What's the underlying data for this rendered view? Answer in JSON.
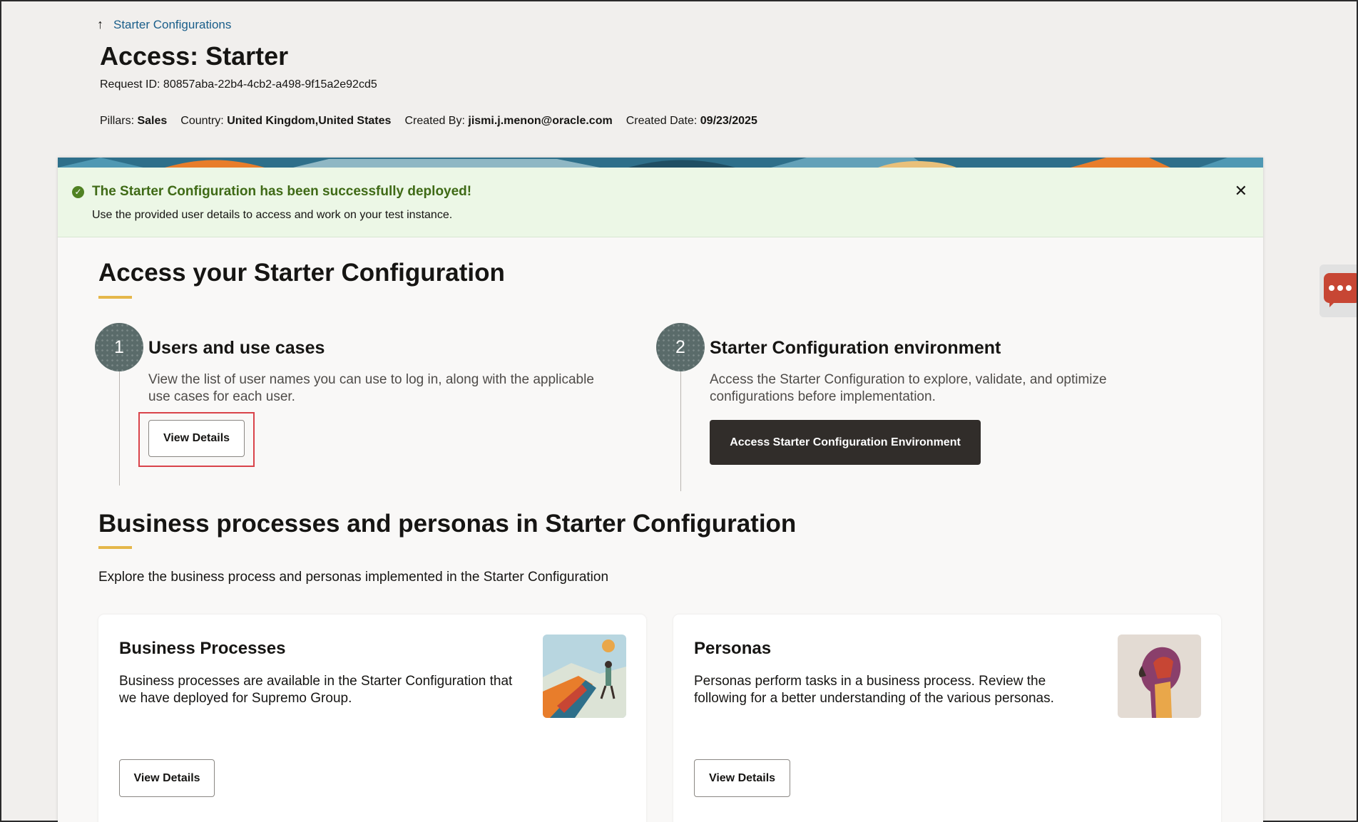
{
  "breadcrumb": {
    "back_label": "Starter Configurations"
  },
  "header": {
    "title": "Access: Starter",
    "request_id": "Request ID: 80857aba-22b4-4cb2-a498-9f15a2e92cd5",
    "meta": {
      "pillars_label": "Pillars:",
      "pillars_value": "Sales",
      "country_label": "Country:",
      "country_value": "United Kingdom,United States",
      "created_by_label": "Created By:",
      "created_by_value": "jismi.j.menon@oracle.com",
      "created_date_label": "Created Date:",
      "created_date_value": "09/23/2025"
    }
  },
  "alert": {
    "title": "The Starter Configuration has been successfully deployed!",
    "message": "Use the provided user details to access and work on your test instance.",
    "close_icon": "✕",
    "check_icon": "✓"
  },
  "access": {
    "title": "Access your Starter Configuration",
    "steps": [
      {
        "number": "1",
        "title": "Users and use cases",
        "description_line1": "View the list of user names you can use to log in, along with the applicable",
        "description_line2": "use cases for each user.",
        "button": "View Details"
      },
      {
        "number": "2",
        "title": "Starter Configuration environment",
        "description_line1": "Access the Starter Configuration to explore, validate, and optimize",
        "description_line2": "configurations before implementation.",
        "button": "Access Starter Configuration Environment"
      }
    ]
  },
  "business": {
    "title": "Business processes and personas in Starter Configuration",
    "intro": "Explore the business process and personas implemented in the Starter Configuration",
    "cards": [
      {
        "title": "Business Processes",
        "description_line1": "Business processes are available in the Starter Configuration that",
        "description_line2": "we have deployed for Supremo Group.",
        "button": "View Details"
      },
      {
        "title": "Personas",
        "description_line1": "Personas perform tasks in a business process. Review the",
        "description_line2": "following for a better understanding of the various personas.",
        "button": "View Details"
      }
    ]
  },
  "colors": {
    "accent_underline": "#e5b74a",
    "success_bg": "#ecf7e6",
    "success_text": "#3f6a16",
    "primary_dark": "#312d2a",
    "chat_red": "#c74634"
  },
  "icons": {
    "back": "up-arrow-icon",
    "success": "check-circle-icon",
    "close": "close-icon",
    "chat": "chat-bubble-icon"
  }
}
